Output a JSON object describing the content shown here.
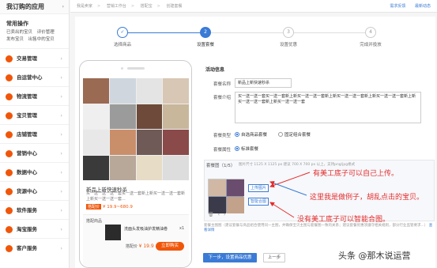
{
  "sidebar": {
    "header": "我订购的应用",
    "common_title": "常用操作",
    "common_links": [
      "已卖出的宝贝",
      "评价管理",
      "发布宝贝",
      "出售中的宝贝"
    ],
    "items": [
      {
        "label": "交易管理"
      },
      {
        "label": "自运营中心"
      },
      {
        "label": "物流管理"
      },
      {
        "label": "宝贝管理"
      },
      {
        "label": "店铺管理"
      },
      {
        "label": "营销中心"
      },
      {
        "label": "数据中心"
      },
      {
        "label": "货源中心"
      },
      {
        "label": "软件服务"
      },
      {
        "label": "淘宝服务"
      },
      {
        "label": "客户服务"
      }
    ]
  },
  "topbar": {
    "crumbs": [
      "我是卖家",
      "营销工作台",
      "搭配宝",
      "创建套餐"
    ],
    "links": [
      "需求反馈",
      "最新动态"
    ]
  },
  "steps": [
    {
      "label": "选择商品",
      "num": "✓",
      "state": "done"
    },
    {
      "label": "设置套餐",
      "num": "2",
      "state": "active"
    },
    {
      "label": "设置优惠",
      "num": "3",
      "state": "todo"
    },
    {
      "label": "完成并投放",
      "num": "4",
      "state": "todo"
    }
  ],
  "preview": {
    "title": "新品上新快速秒杀",
    "desc": "买一送一送一送一套买一送一套新上新买一送一送一套新上新买一送一送一套...",
    "price_tag": "搭配价",
    "price": "¥ 19.9~680.9",
    "combo_title": "搭配商品",
    "combo_item_name": "洗面头发吸油护发精油卷",
    "combo_qty": "x1",
    "combo_price_label": "搭配价",
    "combo_price": "¥ 19.9",
    "buy_label": "立即购买"
  },
  "form": {
    "section_title": "活动信息",
    "name_label": "套餐名称",
    "name_value": "新品上新快速秒杀",
    "intro_label": "套餐介绍",
    "intro_value": "买一送一送一套买一送一套新上新买一送一送一套新上新买一送一送一套新上新买一送一送一套新上新买一送一送一套新上新买一送一送一套",
    "type_label": "套餐类型",
    "type_options": [
      "自选商品套餐",
      "固定组合套餐"
    ],
    "attr_label": "套餐属性",
    "attr_option": "标准套餐",
    "img_label": "套餐图",
    "img_count": "（1/5）",
    "img_hint": "图片尺寸 1125 X 1125 px 建议 700 X 700 px 以上，支持png/jpg格式",
    "upload_btn": "上传图片",
    "smart_btn": "智能合图",
    "note": "套餐主图图（建议套餐与商品组合使用同一主图，并确保宝贝主图与套餐图一致的关系；建议套餐优惠须遵守相关规则，部分行业监管要求...）",
    "note_link": "查看详情",
    "next_btn": "下一步，设置商品优惠",
    "prev_btn": "上一步"
  },
  "annotations": [
    "有美工底子可以自己上传。",
    "这里我是做例子，胡乱点击的宝贝。",
    "没有美工底子可以智能合图。"
  ],
  "watermark": "头条 @那木说运营",
  "colors": {
    "accent": "#3a7bd5",
    "brand": "#f0560a",
    "annotation": "#e52c2c"
  }
}
